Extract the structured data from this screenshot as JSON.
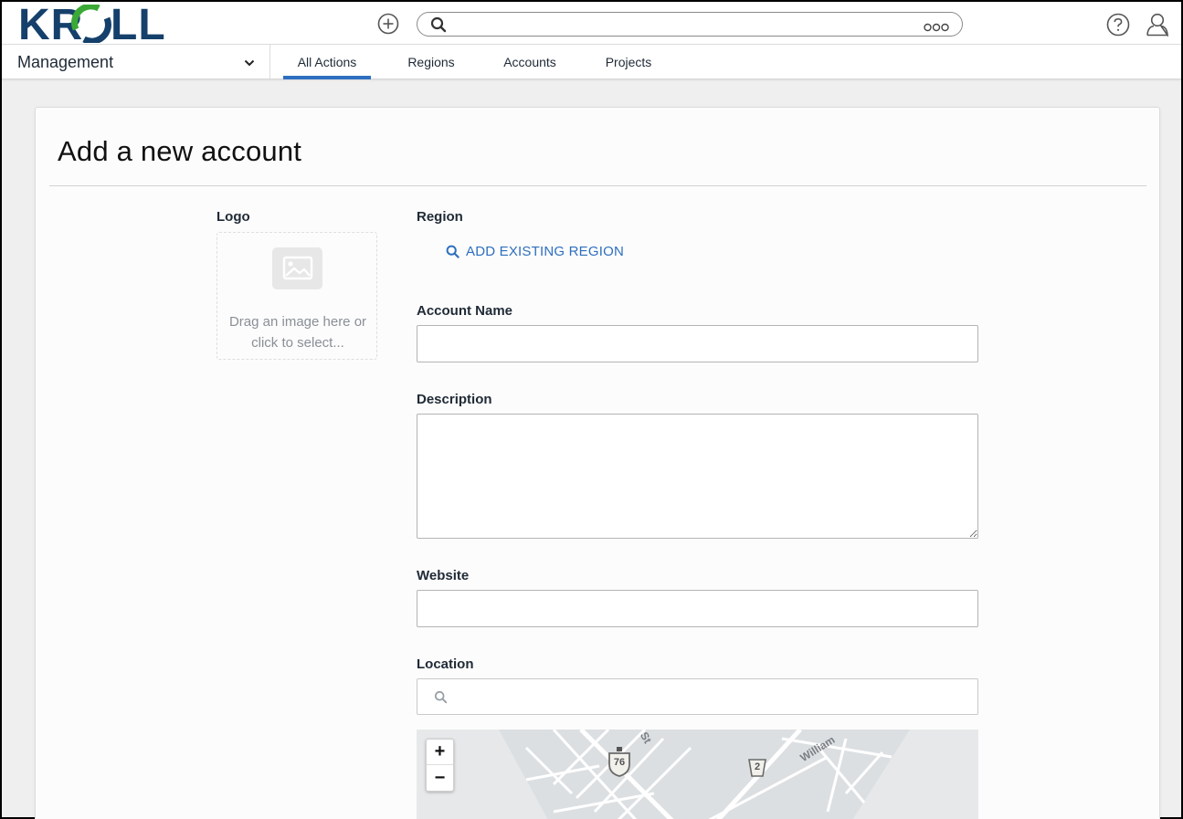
{
  "header": {
    "logo_text": "KROLL",
    "search": {
      "placeholder": ""
    },
    "icons": [
      "add-circle-icon",
      "search-icon",
      "more-dots-icon",
      "help-icon",
      "user-icon"
    ]
  },
  "nav": {
    "workspace": "Management",
    "tabs": [
      {
        "label": "All Actions",
        "active": true
      },
      {
        "label": "Regions",
        "active": false
      },
      {
        "label": "Accounts",
        "active": false
      },
      {
        "label": "Projects",
        "active": false
      }
    ]
  },
  "form": {
    "title": "Add a new account",
    "logo": {
      "label": "Logo",
      "dropzone_text": "Drag an image here or click to select..."
    },
    "region": {
      "label": "Region",
      "add_label": "ADD EXISTING REGION"
    },
    "account_name": {
      "label": "Account Name",
      "value": ""
    },
    "description": {
      "label": "Description",
      "value": ""
    },
    "website": {
      "label": "Website",
      "value": ""
    },
    "location": {
      "label": "Location",
      "search_value": "",
      "map": {
        "zoom_in": "+",
        "zoom_out": "−",
        "street_labels": [
          "St",
          "William"
        ],
        "route_shields": [
          "76",
          "2"
        ]
      }
    }
  },
  "colors": {
    "accent": "#2e6fbf",
    "brand_blue": "#14406b",
    "brand_green": "#3aa935",
    "background": "#efefef"
  }
}
